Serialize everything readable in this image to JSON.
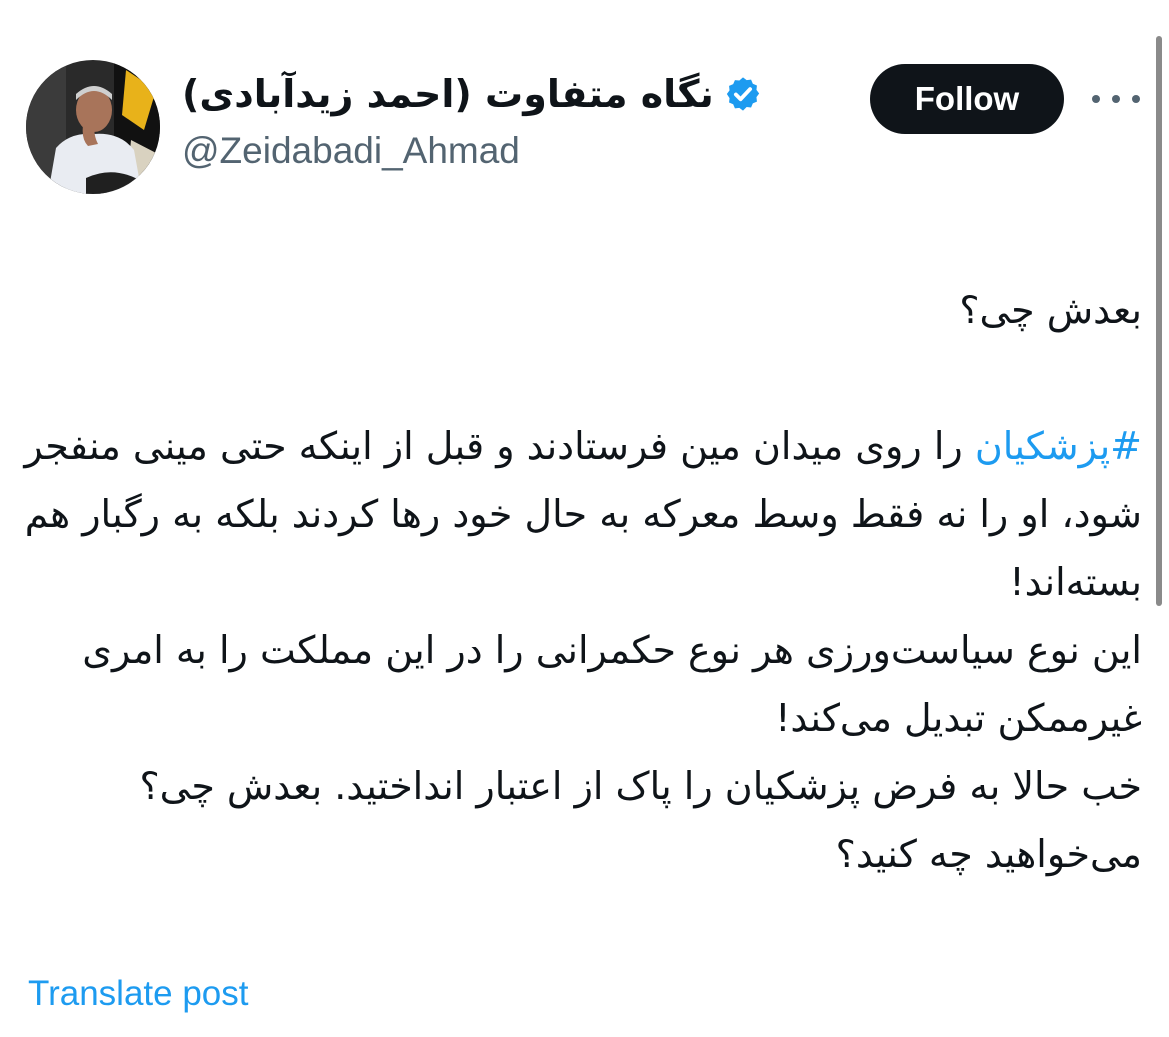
{
  "author": {
    "display_name": "نگاه متفاوت (احمد زیدآبادی)",
    "handle": "@Zeidabadi_Ahmad",
    "verified": true,
    "avatar_icon": "profile-photo",
    "verified_icon": "verified-badge-icon"
  },
  "actions": {
    "follow_label": "Follow",
    "more_icon": "more-options-icon"
  },
  "tweet": {
    "line1": "بعدش چی؟",
    "hashtag": "#پزشکیان",
    "line2_rest": " را روی میدان مین فرستادند و قبل از اینکه حتی مینی منفجر شود، او را نه فقط وسط معرکه به حال خود رها کردند بلکه به رگبار هم بسته‌اند!",
    "line3": "این نوع سیاست‌ورزی هر نوع حکمرانی را در این مملکت را به امری غیرممکن تبدیل می‌کند!",
    "line4": "خب حالا به فرض پزشکیان را پاک از اعتبار انداختید. بعدش چی؟ می‌خواهید چه کنید؟"
  },
  "footer": {
    "translate_label": "Translate post"
  },
  "colors": {
    "link": "#1d9bf0",
    "text": "#0f1419",
    "secondary": "#536471",
    "follow_bg": "#0f1419"
  }
}
